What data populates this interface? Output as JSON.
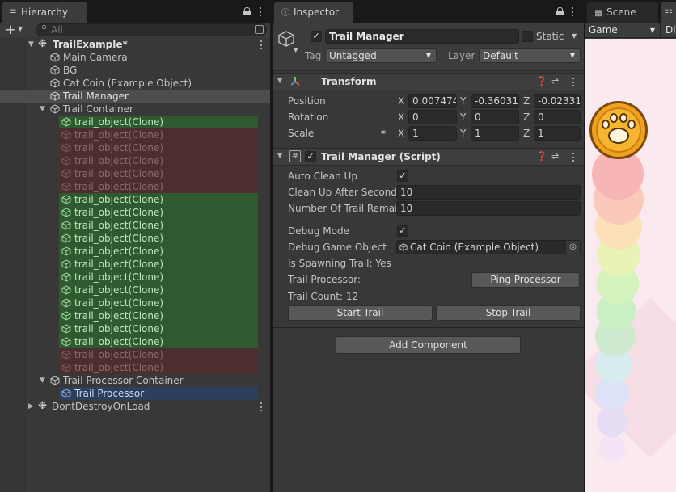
{
  "hierarchy": {
    "tab_label": "Hierarchy",
    "search_placeholder": "All",
    "scene_name": "TrailExample*",
    "items": [
      {
        "label": "Main Camera"
      },
      {
        "label": "BG"
      },
      {
        "label": "Cat Coin (Example Object)"
      },
      {
        "label": "Trail Manager"
      },
      {
        "label": "Trail Container"
      },
      {
        "label": "Trail Processor Container"
      },
      {
        "label": "Trail Processor"
      },
      {
        "label": "DontDestroyOnLoad"
      }
    ],
    "trail_clones": [
      {
        "label": "trail_object(Clone)",
        "state": "active"
      },
      {
        "label": "trail_object(Clone)",
        "state": "inactive"
      },
      {
        "label": "trail_object(Clone)",
        "state": "inactive"
      },
      {
        "label": "trail_object(Clone)",
        "state": "inactive"
      },
      {
        "label": "trail_object(Clone)",
        "state": "inactive"
      },
      {
        "label": "trail_object(Clone)",
        "state": "inactive"
      },
      {
        "label": "trail_object(Clone)",
        "state": "active"
      },
      {
        "label": "trail_object(Clone)",
        "state": "active"
      },
      {
        "label": "trail_object(Clone)",
        "state": "active"
      },
      {
        "label": "trail_object(Clone)",
        "state": "active"
      },
      {
        "label": "trail_object(Clone)",
        "state": "active"
      },
      {
        "label": "trail_object(Clone)",
        "state": "active"
      },
      {
        "label": "trail_object(Clone)",
        "state": "active"
      },
      {
        "label": "trail_object(Clone)",
        "state": "active"
      },
      {
        "label": "trail_object(Clone)",
        "state": "active"
      },
      {
        "label": "trail_object(Clone)",
        "state": "active"
      },
      {
        "label": "trail_object(Clone)",
        "state": "active"
      },
      {
        "label": "trail_object(Clone)",
        "state": "active"
      },
      {
        "label": "trail_object(Clone)",
        "state": "inactive"
      },
      {
        "label": "trail_object(Clone)",
        "state": "inactive"
      }
    ]
  },
  "inspector": {
    "tab_label": "Inspector",
    "object_name": "Trail Manager",
    "static_label": "Static",
    "tag_label": "Tag",
    "tag_value": "Untagged",
    "layer_label": "Layer",
    "layer_value": "Default",
    "transform": {
      "title": "Transform",
      "position_label": "Position",
      "rotation_label": "Rotation",
      "scale_label": "Scale",
      "axes": [
        "X",
        "Y",
        "Z"
      ],
      "position": [
        "0.007474",
        "-0.36031",
        "-0.02331"
      ],
      "rotation": [
        "0",
        "0",
        "0"
      ],
      "scale": [
        "1",
        "1",
        "1"
      ]
    },
    "script": {
      "title": "Trail Manager (Script)",
      "auto_clean_up_label": "Auto Clean Up",
      "clean_up_after_label": "Clean Up After Seconds",
      "clean_up_after_value": "10",
      "number_remain_label": "Number Of Trail Remain",
      "number_remain_value": "10",
      "debug_mode_label": "Debug Mode",
      "debug_game_object_label": "Debug Game Object",
      "debug_game_object_value": "Cat Coin (Example Object)",
      "is_spawning_label": "Is Spawning Trail: Yes",
      "trail_processor_label": "Trail Processor:",
      "ping_processor_label": "Ping Processor",
      "trail_count_label": "Trail Count: 12",
      "start_trail_label": "Start Trail",
      "stop_trail_label": "Stop Trail"
    },
    "add_component_label": "Add Component"
  },
  "scene_tab_label": "Scene",
  "game": {
    "dropdown_label": "Game",
    "extra_tab": "Di"
  },
  "colors": {
    "active_row": "#2f5a2f",
    "inactive_row": "#4d2e2e",
    "selected_row": "#4d4d4d",
    "highlight_row": "#2e3f5c",
    "game_bg": "#fbe9f0"
  },
  "icons": [
    "hierarchy-icon",
    "plus-icon",
    "search-icon",
    "scene-unity-icon",
    "gameobject-cube-icon",
    "lock-icon",
    "kebab-menu-icon",
    "info-icon",
    "transform-axes-icon",
    "script-hash-icon",
    "help-icon",
    "preset-icon",
    "link-icon",
    "target-icon",
    "gamepad-icon",
    "coin-paw-icon"
  ]
}
